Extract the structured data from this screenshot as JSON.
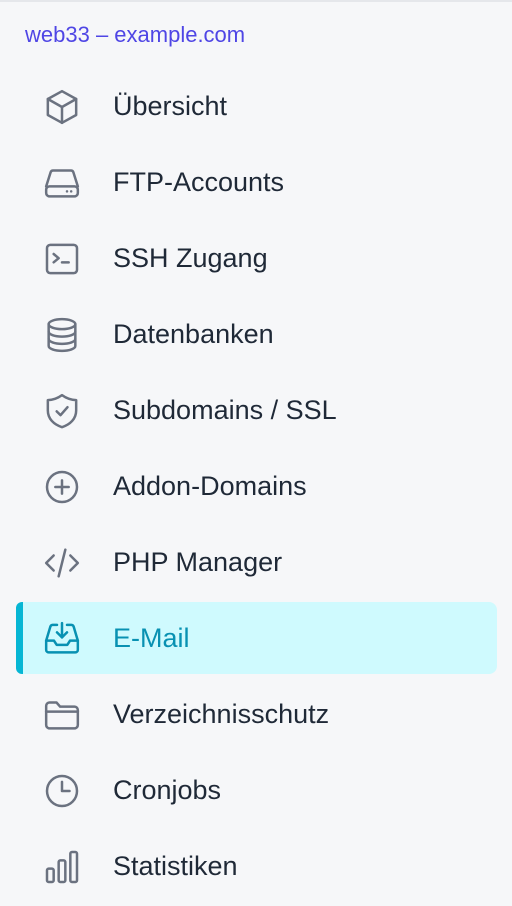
{
  "site": {
    "title": "web33 – example.com"
  },
  "colors": {
    "accent": "#4f46e5",
    "active_bg": "#cffafe",
    "active_bar": "#06b6d4",
    "active_text": "#0891b2",
    "text": "#1f2937",
    "icon": "#6b7280"
  },
  "nav": {
    "items": [
      {
        "label": "Übersicht",
        "icon": "cube-icon",
        "active": false
      },
      {
        "label": "FTP-Accounts",
        "icon": "server-icon",
        "active": false
      },
      {
        "label": "SSH Zugang",
        "icon": "terminal-icon",
        "active": false
      },
      {
        "label": "Datenbanken",
        "icon": "database-icon",
        "active": false
      },
      {
        "label": "Subdomains / SSL",
        "icon": "shield-check-icon",
        "active": false
      },
      {
        "label": "Addon-Domains",
        "icon": "plus-circle-icon",
        "active": false
      },
      {
        "label": "PHP Manager",
        "icon": "code-icon",
        "active": false
      },
      {
        "label": "E-Mail",
        "icon": "inbox-download-icon",
        "active": true
      },
      {
        "label": "Verzeichnisschutz",
        "icon": "folder-icon",
        "active": false
      },
      {
        "label": "Cronjobs",
        "icon": "clock-icon",
        "active": false
      },
      {
        "label": "Statistiken",
        "icon": "bar-chart-icon",
        "active": false
      }
    ]
  }
}
